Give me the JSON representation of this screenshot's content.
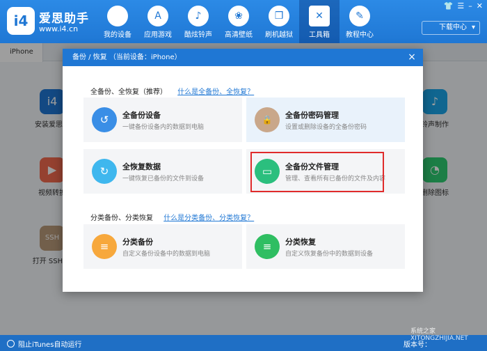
{
  "app": {
    "brand_name": "爱思助手",
    "brand_url": "www.i4.cn",
    "logo_text": "i4"
  },
  "nav": [
    {
      "label": "我的设备",
      "icon": "apple-icon",
      "glyph": ""
    },
    {
      "label": "应用游戏",
      "icon": "app-store-icon",
      "glyph": "A"
    },
    {
      "label": "酷炫铃声",
      "icon": "bell-icon",
      "glyph": "♪"
    },
    {
      "label": "高清壁纸",
      "icon": "flower-icon",
      "glyph": "❀"
    },
    {
      "label": "刷机越狱",
      "icon": "dropbox-icon",
      "glyph": "❒"
    },
    {
      "label": "工具箱",
      "icon": "tools-icon",
      "glyph": "✕"
    },
    {
      "label": "教程中心",
      "icon": "graduation-icon",
      "glyph": "✎"
    }
  ],
  "download_button": "下载中心",
  "window_controls": {
    "shirt": "👕",
    "menu": "☰",
    "minimize": "–",
    "close": "✕"
  },
  "device_tab": "iPhone",
  "background_apps": [
    {
      "label": "安装爱思移",
      "icon": "i4-app-icon",
      "glyph": "i4",
      "color": "#1f77d4"
    },
    {
      "label": "视频转换",
      "icon": "video-icon",
      "glyph": "▶",
      "color": "#f06a4e"
    },
    {
      "label": "打开 SSH 通",
      "icon": "ssh-icon",
      "glyph": "SSH",
      "color": "#b89a7a"
    },
    {
      "label": "铃声制作",
      "icon": "bell-maker-icon",
      "glyph": "♪",
      "color": "#1aa5e8"
    },
    {
      "label": "删除图标",
      "icon": "pie-icon",
      "glyph": "◔",
      "color": "#2ecc71"
    }
  ],
  "modal": {
    "title": "备份 / 恢复 （当前设备：iPhone）",
    "close": "×",
    "section1": {
      "label": "全备份、全恢复（推荐）",
      "link": "什么是全备份、全恢复？"
    },
    "section2": {
      "label": "分类备份、分类恢复",
      "link": "什么是分类备份、分类恢复？"
    },
    "cards": [
      {
        "title": "全备份设备",
        "desc": "一键备份设备内的数据到电脑",
        "icon": "backup-icon",
        "glyph": "↺",
        "color": "#3a8ee6"
      },
      {
        "title": "全备份密码管理",
        "desc": "设置或删除设备的全备份密码",
        "icon": "lock-icon",
        "glyph": "🔒",
        "color": "#c9a78a"
      },
      {
        "title": "全恢复数据",
        "desc": "一键恢复已备份的文件到设备",
        "icon": "restore-icon",
        "glyph": "↻",
        "color": "#3fb7ee"
      },
      {
        "title": "全备份文件管理",
        "desc": "管理、查看所有已备份的文件及内容",
        "icon": "folder-icon",
        "glyph": "▭",
        "color": "#2bbf7e"
      },
      {
        "title": "分类备份",
        "desc": "自定义备份设备中的数据到电脑",
        "icon": "category-backup-icon",
        "glyph": "≡",
        "color": "#f7a83c"
      },
      {
        "title": "分类恢复",
        "desc": "自定义恢复备份中的数据到设备",
        "icon": "category-restore-icon",
        "glyph": "≡",
        "color": "#2fbe62"
      }
    ]
  },
  "status": {
    "left": "阻止iTunes自动运行",
    "right": "版本号："
  },
  "watermark": "系统之家 XITONGZHIJIA.NET"
}
